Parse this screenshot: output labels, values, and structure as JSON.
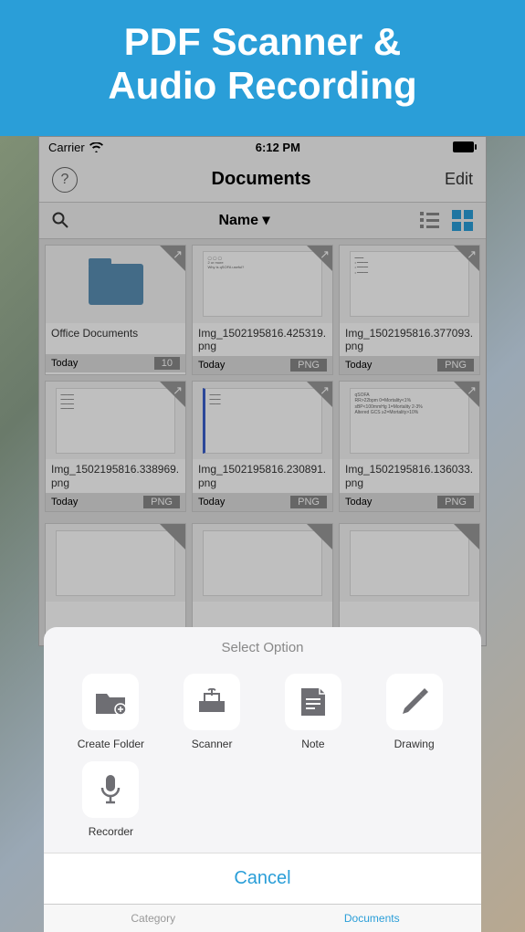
{
  "promo": {
    "line1": "PDF Scanner &",
    "line2": "Audio Recording"
  },
  "status": {
    "carrier": "Carrier",
    "time": "6:12 PM"
  },
  "nav": {
    "title": "Documents",
    "edit": "Edit"
  },
  "sort": {
    "label": "Name ▾"
  },
  "items": [
    {
      "name": "Office Documents",
      "date": "Today",
      "badge": "10",
      "type": "folder"
    },
    {
      "name": "Img_1502195816.425319.png",
      "date": "Today",
      "badge": "PNG",
      "type": "doc"
    },
    {
      "name": "Img_1502195816.377093.png",
      "date": "Today",
      "badge": "PNG",
      "type": "doc"
    },
    {
      "name": "Img_1502195816.338969.png",
      "date": "Today",
      "badge": "PNG",
      "type": "doc"
    },
    {
      "name": "Img_1502195816.230891.png",
      "date": "Today",
      "badge": "PNG",
      "type": "doc"
    },
    {
      "name": "Img_1502195816.136033.png",
      "date": "Today",
      "badge": "PNG",
      "type": "doc"
    }
  ],
  "sheet": {
    "title": "Select Option",
    "options": [
      {
        "label": "Create Folder"
      },
      {
        "label": "Scanner"
      },
      {
        "label": "Note"
      },
      {
        "label": "Drawing"
      },
      {
        "label": "Recorder"
      }
    ],
    "cancel": "Cancel"
  },
  "tabs": {
    "category": "Category",
    "documents": "Documents"
  }
}
